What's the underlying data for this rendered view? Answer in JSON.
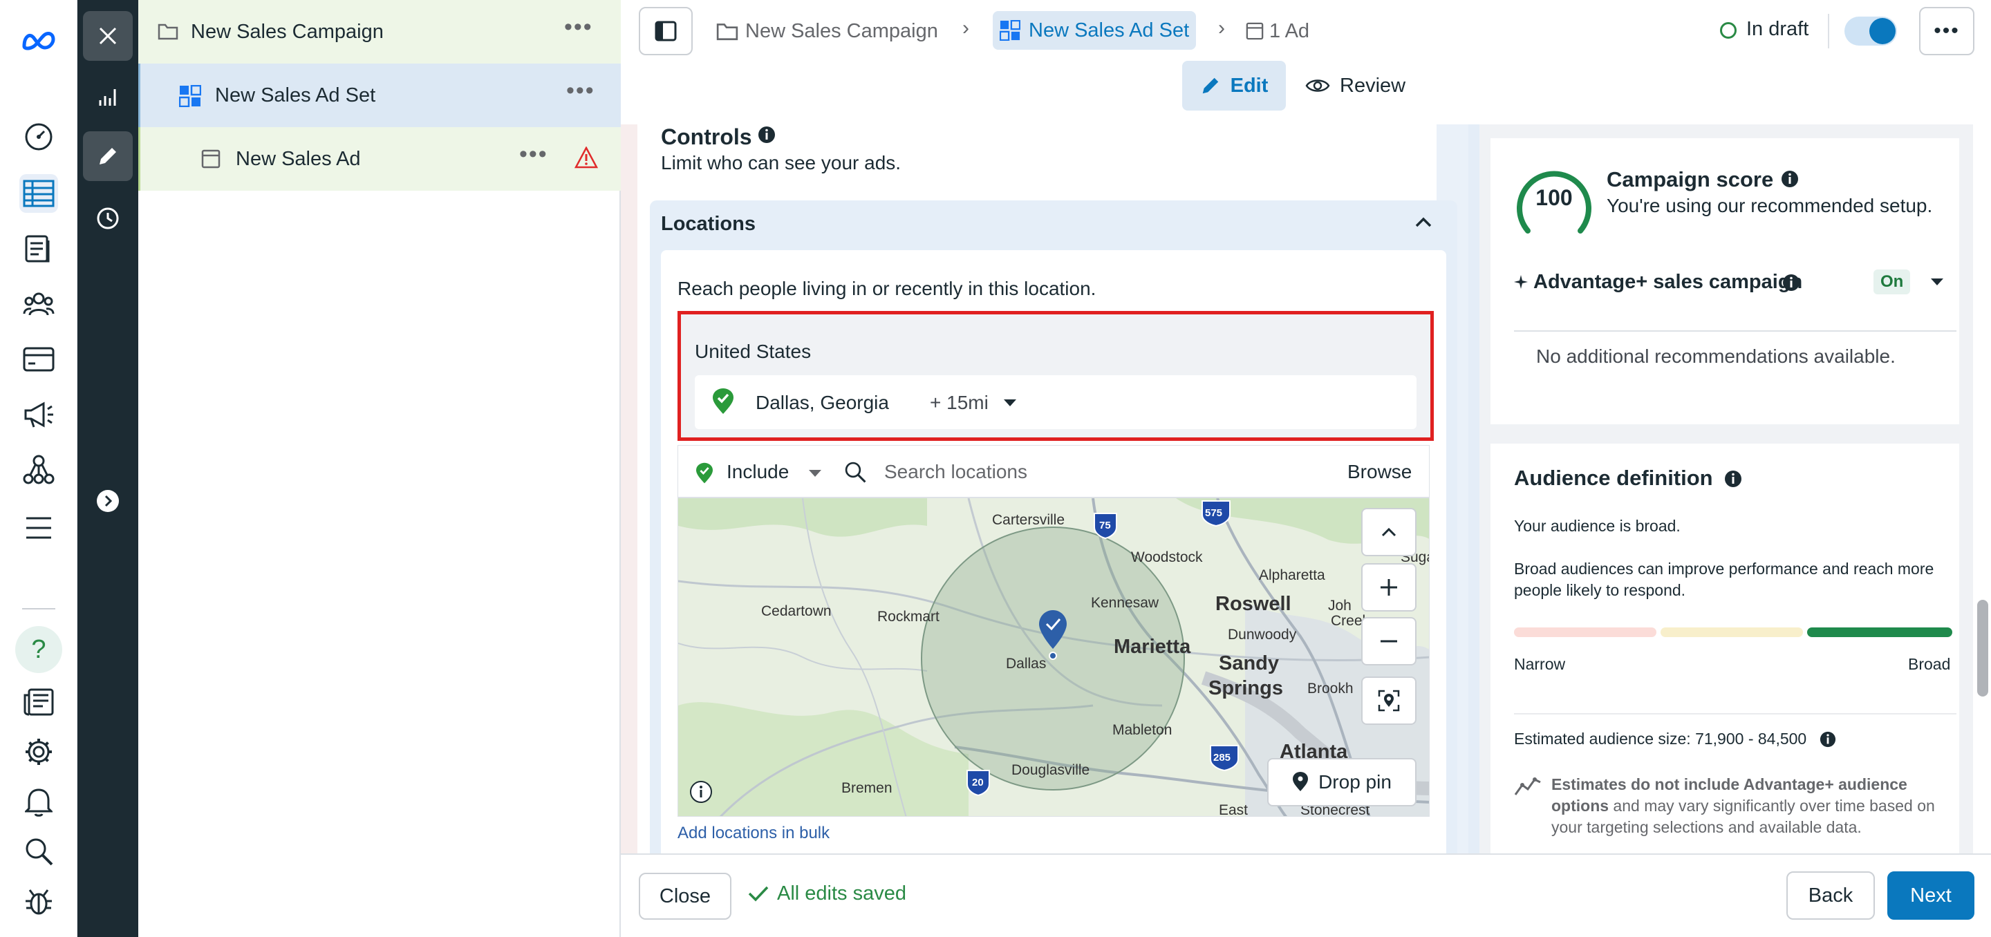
{
  "nav_rail": {
    "items": [
      "meta-logo-icon",
      "performance-icon",
      "campaigns-table-icon",
      "pages-icon",
      "audiences-icon",
      "billing-icon",
      "ads-manager-megaphone-icon",
      "business-tools-icon",
      "menu-icon",
      "help-icon",
      "news-icon",
      "settings-icon",
      "notifications-icon",
      "search-icon",
      "bug-report-icon"
    ]
  },
  "tree": {
    "campaign": "New Sales Campaign",
    "adset": "New Sales Ad Set",
    "ad": "New Sales Ad"
  },
  "breadcrumb": {
    "campaign": "New Sales Campaign",
    "adset": "New Sales Ad Set",
    "ad": "1 Ad"
  },
  "status": {
    "label": "In draft",
    "toggle_on": true
  },
  "mode_tabs": {
    "edit": "Edit",
    "review": "Review"
  },
  "controls": {
    "title": "Controls",
    "subtitle": "Limit who can see your ads."
  },
  "locations": {
    "title": "Locations",
    "intro": "Reach people living in or recently in this location.",
    "country": "United States",
    "selected_location": "Dallas, Georgia",
    "radius": "+ 15mi",
    "include_label": "Include",
    "search_placeholder": "Search locations",
    "browse": "Browse",
    "bulk_link": "Add locations in bulk",
    "drop_pin": "Drop pin"
  },
  "map": {
    "places": [
      "Cartersville",
      "Woodstock",
      "Alpharetta",
      "Kennesaw",
      "Roswell",
      "Cedartown",
      "Rockmart",
      "Dunwoody",
      "Marietta",
      "Sandy Springs",
      "Dallas",
      "Brookh",
      "Mableton",
      "Atlanta",
      "Douglasville",
      "Bremen",
      "Stonecrest",
      "East",
      "Joh Creek",
      "Suga"
    ],
    "highway_shields": [
      "75",
      "575",
      "20",
      "285"
    ],
    "accent_color": "#2d5fa8"
  },
  "campaign_score": {
    "score": "100",
    "title": "Campaign score",
    "subtitle": "You're using our recommended setup.",
    "advantage_label": "Advantage+ sales campaign",
    "advantage_state": "On",
    "no_recs": "No additional recommendations available."
  },
  "audience": {
    "title": "Audience definition",
    "broad_text": "Your audience is broad.",
    "explain": "Broad audiences can improve performance and reach more people likely to respond.",
    "narrow": "Narrow",
    "broad": "Broad",
    "level": "broad",
    "estimated_size": "Estimated audience size: 71,900 - 84,500",
    "estimates_bold": "Estimates do not include Advantage+ audience options",
    "estimates_rest": " and may vary significantly over time based on your targeting selections and available data."
  },
  "footer": {
    "close": "Close",
    "saved": "All edits saved",
    "back": "Back",
    "next": "Next"
  },
  "colors": {
    "brand_blue": "#0a78be",
    "success_green": "#2a8a45",
    "warning_red": "#e02b2b",
    "dark_rail": "#1c2b33"
  }
}
